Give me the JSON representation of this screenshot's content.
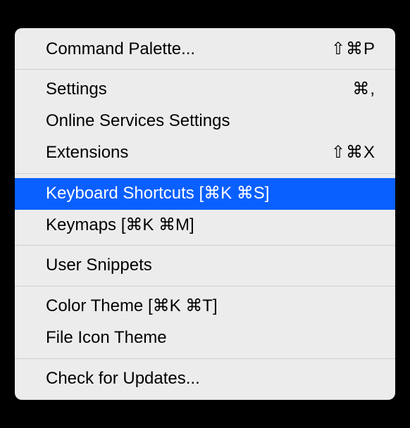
{
  "menu": {
    "groups": [
      [
        {
          "label": "Command Palette...",
          "shortcut": "⇧⌘P",
          "name": "menu-command-palette",
          "selected": false
        }
      ],
      [
        {
          "label": "Settings",
          "shortcut": "⌘,",
          "name": "menu-settings",
          "selected": false
        },
        {
          "label": "Online Services Settings",
          "shortcut": "",
          "name": "menu-online-services-settings",
          "selected": false
        },
        {
          "label": "Extensions",
          "shortcut": "⇧⌘X",
          "name": "menu-extensions",
          "selected": false
        }
      ],
      [
        {
          "label": "Keyboard Shortcuts [⌘K ⌘S]",
          "shortcut": "",
          "name": "menu-keyboard-shortcuts",
          "selected": true
        },
        {
          "label": "Keymaps [⌘K ⌘M]",
          "shortcut": "",
          "name": "menu-keymaps",
          "selected": false
        }
      ],
      [
        {
          "label": "User Snippets",
          "shortcut": "",
          "name": "menu-user-snippets",
          "selected": false
        }
      ],
      [
        {
          "label": "Color Theme [⌘K ⌘T]",
          "shortcut": "",
          "name": "menu-color-theme",
          "selected": false
        },
        {
          "label": "File Icon Theme",
          "shortcut": "",
          "name": "menu-file-icon-theme",
          "selected": false
        }
      ],
      [
        {
          "label": "Check for Updates...",
          "shortcut": "",
          "name": "menu-check-updates",
          "selected": false
        }
      ]
    ]
  }
}
